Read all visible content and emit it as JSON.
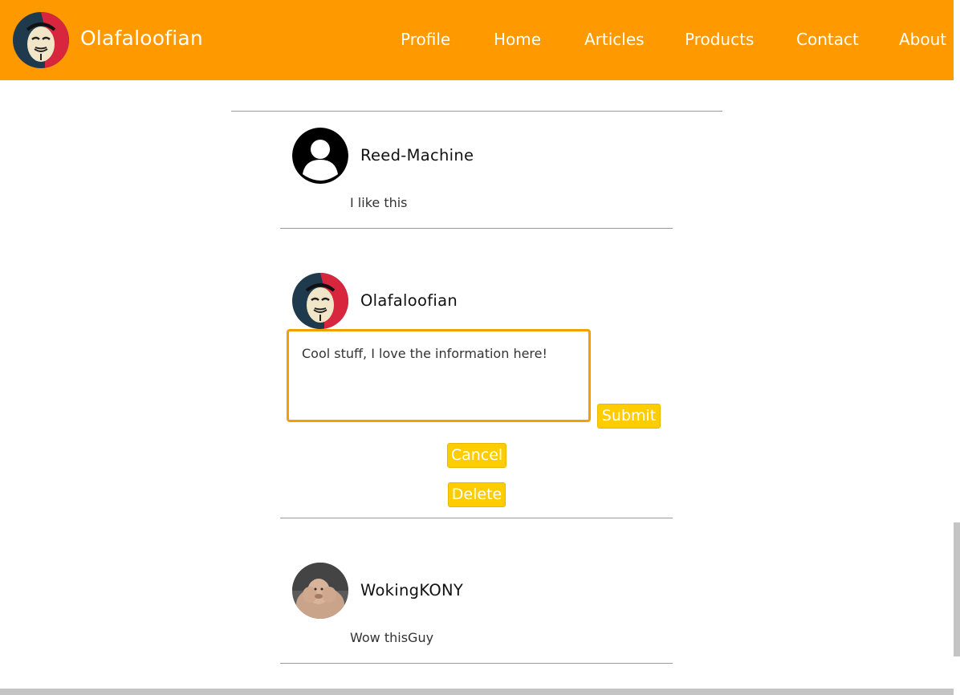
{
  "header": {
    "brand_name": "Olafaloofian",
    "brand_avatar_icon": "anonymous-mask-avatar-icon",
    "bg_color": "#ff9900",
    "nav": [
      "Profile",
      "Home",
      "Articles",
      "Products",
      "Contact",
      "About"
    ]
  },
  "comments": [
    {
      "username": "Reed-Machine",
      "text": "I like this",
      "avatar_icon": "default-user-avatar-icon"
    },
    {
      "username": "Olafaloofian",
      "edit_value": "Cool stuff, I love the information here!",
      "avatar_icon": "anonymous-mask-avatar-icon"
    },
    {
      "username": "WokingKONY",
      "text": "Wow thisGuy",
      "avatar_icon": "photo-avatar-icon"
    }
  ],
  "buttons": {
    "submit": "Submit",
    "cancel": "Cancel",
    "delete": "Delete"
  },
  "colors": {
    "accent": "#ffcc00",
    "edit_border": "#f0a000"
  }
}
